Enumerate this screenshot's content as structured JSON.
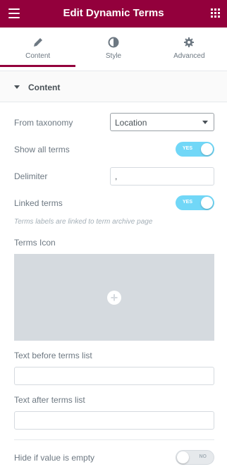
{
  "header": {
    "title": "Edit Dynamic Terms",
    "menu_icon": "hamburger-menu-icon",
    "apps_icon": "grid-apps-icon",
    "background": "#93003c"
  },
  "tabs": [
    {
      "label": "Content",
      "icon": "pencil-icon",
      "active": true
    },
    {
      "label": "Style",
      "icon": "half-circle-icon",
      "active": false
    },
    {
      "label": "Advanced",
      "icon": "gear-icon",
      "active": false
    }
  ],
  "section": {
    "title": "Content"
  },
  "fields": {
    "taxonomy_label": "From taxonomy",
    "taxonomy_value": "Location",
    "show_all_label": "Show all terms",
    "show_all_state": "YES",
    "delimiter_label": "Delimiter",
    "delimiter_value": ",",
    "linked_label": "Linked terms",
    "linked_state": "YES",
    "linked_hint": "Terms labels are linked to term archive page",
    "icon_label": "Terms Icon",
    "before_label": "Text before terms list",
    "before_value": "",
    "after_label": "Text after terms list",
    "after_value": "",
    "hide_empty_label": "Hide if value is empty",
    "hide_empty_state": "NO"
  },
  "colors": {
    "accent": "#93003c",
    "switch_on": "#71d7f7"
  }
}
